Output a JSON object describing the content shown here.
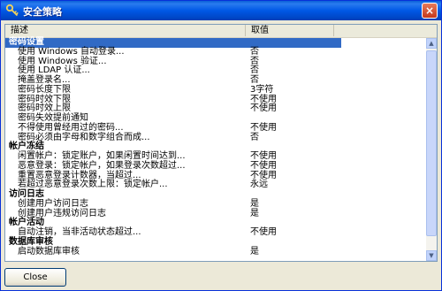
{
  "window": {
    "title": "安全策略",
    "close_glyph": "×"
  },
  "columns": {
    "description": "描述",
    "value": "取值"
  },
  "rows": [
    {
      "type": "category",
      "desc": "密码设置",
      "value": "",
      "selected": true
    },
    {
      "type": "item",
      "desc": "使用 Windows 自动登录...",
      "value": "否"
    },
    {
      "type": "item",
      "desc": "使用 Windows 验证...",
      "value": "否"
    },
    {
      "type": "item",
      "desc": "使用 LDAP 认证...",
      "value": "否"
    },
    {
      "type": "item",
      "desc": "掩盖登录名...",
      "value": "否"
    },
    {
      "type": "item",
      "desc": "密码长度下限",
      "value": "3字符"
    },
    {
      "type": "item",
      "desc": "密码时效下限",
      "value": "不使用"
    },
    {
      "type": "item",
      "desc": "密码时效上限",
      "value": "不使用"
    },
    {
      "type": "item",
      "desc": "密码失效提前通知",
      "value": ""
    },
    {
      "type": "item",
      "desc": "不得使用曾经用过的密码...",
      "value": "不使用"
    },
    {
      "type": "item",
      "desc": "密码必须由字母和数字组合而成...",
      "value": "否"
    },
    {
      "type": "category",
      "desc": "帐户冻结",
      "value": ""
    },
    {
      "type": "item",
      "desc": "闲置帐户：锁定账户，如果闲置时间达到...",
      "value": "不使用"
    },
    {
      "type": "item",
      "desc": "恶意登录：锁定帐户，如果登录次数超过...",
      "value": "不使用"
    },
    {
      "type": "item",
      "desc": "重置恶意登录计数器，当超过...",
      "value": "不使用"
    },
    {
      "type": "item",
      "desc": "若超过恶意登录次数上限：锁定帐户...",
      "value": "永远"
    },
    {
      "type": "category",
      "desc": "访问日志",
      "value": ""
    },
    {
      "type": "item",
      "desc": "创建用户访问日志",
      "value": "是"
    },
    {
      "type": "item",
      "desc": "创建用户违规访问日志",
      "value": "是"
    },
    {
      "type": "category",
      "desc": "帐户活动",
      "value": ""
    },
    {
      "type": "item",
      "desc": "自动注销，当非活动状态超过...",
      "value": "不使用"
    },
    {
      "type": "category",
      "desc": "数据库审核",
      "value": ""
    },
    {
      "type": "item",
      "desc": "启动数据库审核",
      "value": "是"
    }
  ],
  "buttons": {
    "close": "Close"
  }
}
